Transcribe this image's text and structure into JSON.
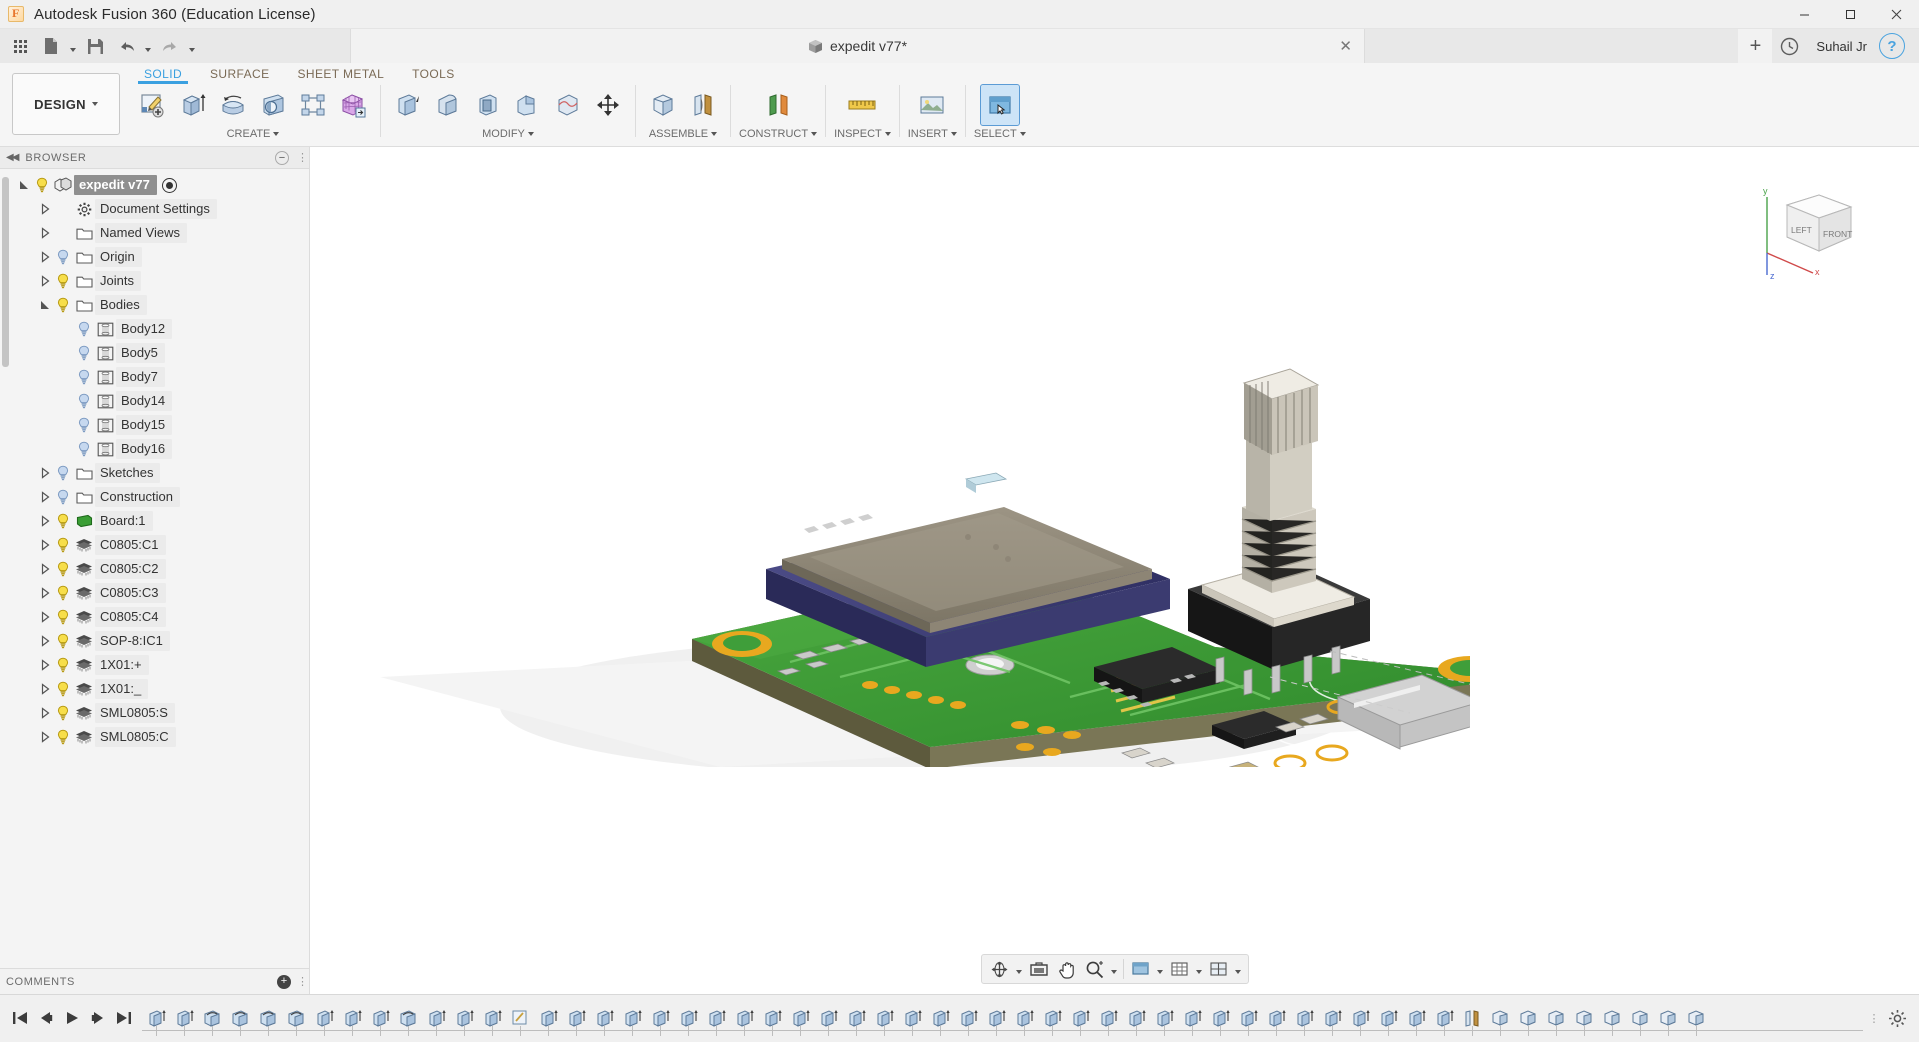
{
  "window": {
    "app_title": "Autodesk Fusion 360 (Education License)",
    "minimize": "─",
    "maximize": "☐",
    "close": "✕"
  },
  "quick_access": {
    "grid_icon": "app-grid-icon",
    "new_icon": "new-document-icon",
    "save_icon": "save-icon",
    "undo_icon": "undo-icon",
    "redo_icon": "redo-icon",
    "document_tab": "expedit v77*",
    "tab_close": "✕",
    "add_tab": "+",
    "history_icon": "job-status-icon",
    "user_name": "Suhail Jr",
    "help_label": "?"
  },
  "ribbon": {
    "workspace": "DESIGN",
    "tabs": [
      {
        "label": "SOLID",
        "active": true
      },
      {
        "label": "SURFACE",
        "active": false
      },
      {
        "label": "SHEET METAL",
        "active": false
      },
      {
        "label": "TOOLS",
        "active": false
      }
    ],
    "panels": [
      {
        "title": "CREATE",
        "has_caret": true,
        "buttons": [
          {
            "name": "create-sketch-button",
            "icon": "create-sketch-icon",
            "selected": false
          },
          {
            "name": "extrude-button",
            "icon": "extrude-icon",
            "selected": false
          },
          {
            "name": "revolve-button",
            "icon": "revolve-icon",
            "selected": false
          },
          {
            "name": "sweep-button",
            "icon": "hole-icon",
            "selected": false
          },
          {
            "name": "pattern-button",
            "icon": "pattern-icon",
            "selected": false
          },
          {
            "name": "create-mesh-button",
            "icon": "mesh-icon",
            "selected": false
          }
        ]
      },
      {
        "title": "MODIFY",
        "has_caret": true,
        "buttons": [
          {
            "name": "press-pull-button",
            "icon": "press-pull-icon",
            "selected": false
          },
          {
            "name": "fillet-button",
            "icon": "fillet-icon",
            "selected": false
          },
          {
            "name": "shell-button",
            "icon": "shell-icon",
            "selected": false
          },
          {
            "name": "combine-button",
            "icon": "combine-icon",
            "selected": false
          },
          {
            "name": "split-face-button",
            "icon": "split-face-icon",
            "selected": false
          },
          {
            "name": "move-copy-button",
            "icon": "move-copy-icon",
            "selected": false
          }
        ]
      },
      {
        "title": "ASSEMBLE",
        "has_caret": true,
        "buttons": [
          {
            "name": "new-component-button",
            "icon": "new-component-icon",
            "selected": false
          },
          {
            "name": "joint-button",
            "icon": "joint-icon",
            "selected": false
          }
        ]
      },
      {
        "title": "CONSTRUCT",
        "has_caret": true,
        "buttons": [
          {
            "name": "offset-plane-button",
            "icon": "offset-plane-icon",
            "selected": false
          }
        ]
      },
      {
        "title": "INSPECT",
        "has_caret": true,
        "buttons": [
          {
            "name": "measure-button",
            "icon": "measure-icon",
            "selected": false
          }
        ]
      },
      {
        "title": "INSERT",
        "has_caret": true,
        "buttons": [
          {
            "name": "insert-mcmaster-button",
            "icon": "insert-image-icon",
            "selected": false
          }
        ]
      },
      {
        "title": "SELECT",
        "has_caret": true,
        "buttons": [
          {
            "name": "select-button",
            "icon": "select-icon",
            "selected": true
          }
        ]
      }
    ]
  },
  "browser": {
    "header": "BROWSER",
    "collapse_icon": "collapse-left-icon",
    "minimize_icon": "minimize-panel-icon",
    "tree": [
      {
        "label": "expedit v77",
        "depth": 0,
        "state": "open",
        "bulb": "on",
        "icon": "component-icon",
        "selected": true,
        "radio": true
      },
      {
        "label": "Document Settings",
        "depth": 1,
        "state": "closed",
        "bulb": "none",
        "icon": "gear-icon",
        "selected": false,
        "radio": false
      },
      {
        "label": "Named Views",
        "depth": 1,
        "state": "closed",
        "bulb": "none",
        "icon": "folder-icon",
        "selected": false,
        "radio": false
      },
      {
        "label": "Origin",
        "depth": 1,
        "state": "closed",
        "bulb": "off",
        "icon": "folder-icon",
        "selected": false,
        "radio": false
      },
      {
        "label": "Joints",
        "depth": 1,
        "state": "closed",
        "bulb": "on",
        "icon": "folder-icon",
        "selected": false,
        "radio": false
      },
      {
        "label": "Bodies",
        "depth": 1,
        "state": "open",
        "bulb": "on",
        "icon": "folder-icon",
        "selected": false,
        "radio": false
      },
      {
        "label": "Body12",
        "depth": 2,
        "state": "none",
        "bulb": "off",
        "icon": "body-icon",
        "selected": false,
        "radio": false
      },
      {
        "label": "Body5",
        "depth": 2,
        "state": "none",
        "bulb": "off",
        "icon": "body-icon",
        "selected": false,
        "radio": false
      },
      {
        "label": "Body7",
        "depth": 2,
        "state": "none",
        "bulb": "off",
        "icon": "body-icon",
        "selected": false,
        "radio": false
      },
      {
        "label": "Body14",
        "depth": 2,
        "state": "none",
        "bulb": "off",
        "icon": "body-icon",
        "selected": false,
        "radio": false
      },
      {
        "label": "Body15",
        "depth": 2,
        "state": "none",
        "bulb": "off",
        "icon": "body-icon",
        "selected": false,
        "radio": false
      },
      {
        "label": "Body16",
        "depth": 2,
        "state": "none",
        "bulb": "off",
        "icon": "body-icon",
        "selected": false,
        "radio": false
      },
      {
        "label": "Sketches",
        "depth": 1,
        "state": "closed",
        "bulb": "off",
        "icon": "folder-icon",
        "selected": false,
        "radio": false
      },
      {
        "label": "Construction",
        "depth": 1,
        "state": "closed",
        "bulb": "off",
        "icon": "folder-icon",
        "selected": false,
        "radio": false
      },
      {
        "label": "Board:1",
        "depth": 1,
        "state": "closed",
        "bulb": "on",
        "icon": "pcb-board-icon",
        "selected": false,
        "radio": false
      },
      {
        "label": "C0805:C1",
        "depth": 1,
        "state": "closed",
        "bulb": "on",
        "icon": "chip-icon",
        "selected": false,
        "radio": false
      },
      {
        "label": "C0805:C2",
        "depth": 1,
        "state": "closed",
        "bulb": "on",
        "icon": "chip-icon",
        "selected": false,
        "radio": false
      },
      {
        "label": "C0805:C3",
        "depth": 1,
        "state": "closed",
        "bulb": "on",
        "icon": "chip-icon",
        "selected": false,
        "radio": false
      },
      {
        "label": "C0805:C4",
        "depth": 1,
        "state": "closed",
        "bulb": "on",
        "icon": "chip-icon",
        "selected": false,
        "radio": false
      },
      {
        "label": "SOP-8:IC1",
        "depth": 1,
        "state": "closed",
        "bulb": "on",
        "icon": "chip-icon",
        "selected": false,
        "radio": false
      },
      {
        "label": "1X01:+",
        "depth": 1,
        "state": "closed",
        "bulb": "on",
        "icon": "chip-icon",
        "selected": false,
        "radio": false
      },
      {
        "label": "1X01:_",
        "depth": 1,
        "state": "closed",
        "bulb": "on",
        "icon": "chip-icon",
        "selected": false,
        "radio": false
      },
      {
        "label": "SML0805:S",
        "depth": 1,
        "state": "closed",
        "bulb": "on",
        "icon": "chip-icon",
        "selected": false,
        "radio": false
      },
      {
        "label": "SML0805:C",
        "depth": 1,
        "state": "closed",
        "bulb": "on",
        "icon": "chip-icon",
        "selected": false,
        "radio": false
      }
    ]
  },
  "comments": {
    "label": "COMMENTS",
    "add_icon": "add-comment-icon"
  },
  "canvas": {
    "viewcube": {
      "faces": {
        "left": "LEFT",
        "front": "FRONT"
      },
      "axis_labels": {
        "x": "x",
        "y": "y",
        "z": "z"
      }
    },
    "model_description": "PCB assembly with rotary encoder, LCD module and SMD components",
    "colors": {
      "pcb_green": "#3f9e3a",
      "pcb_green_dark": "#2f7a2c",
      "pad_gold": "#f0b32a",
      "lcd_blue": "#3f3f7a",
      "knob_gray": "#d8d4cb",
      "encoder_black": "#1d1d1d",
      "board_edge": "#6e6b4a",
      "shadow": "#e8e8e8"
    }
  },
  "navbar": {
    "buttons": [
      {
        "name": "orbit-button",
        "icon": "orbit-icon",
        "caret": true
      },
      {
        "name": "look-at-button",
        "icon": "look-at-icon",
        "caret": false
      },
      {
        "name": "pan-button",
        "icon": "pan-hand-icon",
        "caret": false
      },
      {
        "name": "zoom-button",
        "icon": "zoom-magnifier-icon",
        "caret": true
      },
      {
        "name": "display-settings-button",
        "icon": "display-settings-icon",
        "caret": true
      },
      {
        "name": "grid-snaps-button",
        "icon": "grid-snaps-icon",
        "caret": true
      },
      {
        "name": "viewports-button",
        "icon": "viewports-icon",
        "caret": true
      }
    ]
  },
  "timeline": {
    "playback": [
      {
        "name": "timeline-go-start",
        "icon": "skip-back-icon"
      },
      {
        "name": "timeline-step-back",
        "icon": "step-back-icon"
      },
      {
        "name": "timeline-play",
        "icon": "play-icon"
      },
      {
        "name": "timeline-step-forward",
        "icon": "step-forward-icon"
      },
      {
        "name": "timeline-go-end",
        "icon": "skip-end-icon"
      }
    ],
    "features": [
      "extrude-feature",
      "extrude-feature",
      "revolve-feature",
      "revolve-feature",
      "revolve-feature",
      "revolve-feature",
      "extrude-feature",
      "extrude-feature",
      "extrude-feature",
      "revolve-feature",
      "extrude-feature",
      "extrude-feature",
      "extrude-feature",
      "sketch-feature",
      "extrude-feature",
      "extrude-feature",
      "extrude-feature",
      "extrude-feature",
      "extrude-feature",
      "extrude-feature",
      "extrude-feature",
      "extrude-feature",
      "extrude-feature",
      "extrude-feature",
      "extrude-feature",
      "extrude-feature",
      "extrude-feature",
      "extrude-feature",
      "extrude-feature",
      "extrude-feature",
      "extrude-feature",
      "extrude-feature",
      "extrude-feature",
      "extrude-feature",
      "extrude-feature",
      "extrude-feature",
      "extrude-feature",
      "extrude-feature",
      "extrude-feature",
      "extrude-feature",
      "extrude-feature",
      "extrude-feature",
      "extrude-feature",
      "extrude-feature",
      "extrude-feature",
      "extrude-feature",
      "extrude-feature",
      "joint-feature",
      "component-feature",
      "component-feature",
      "component-feature",
      "component-feature",
      "component-feature",
      "component-feature",
      "component-feature",
      "component-feature"
    ],
    "settings_icon": "timeline-settings-icon"
  }
}
